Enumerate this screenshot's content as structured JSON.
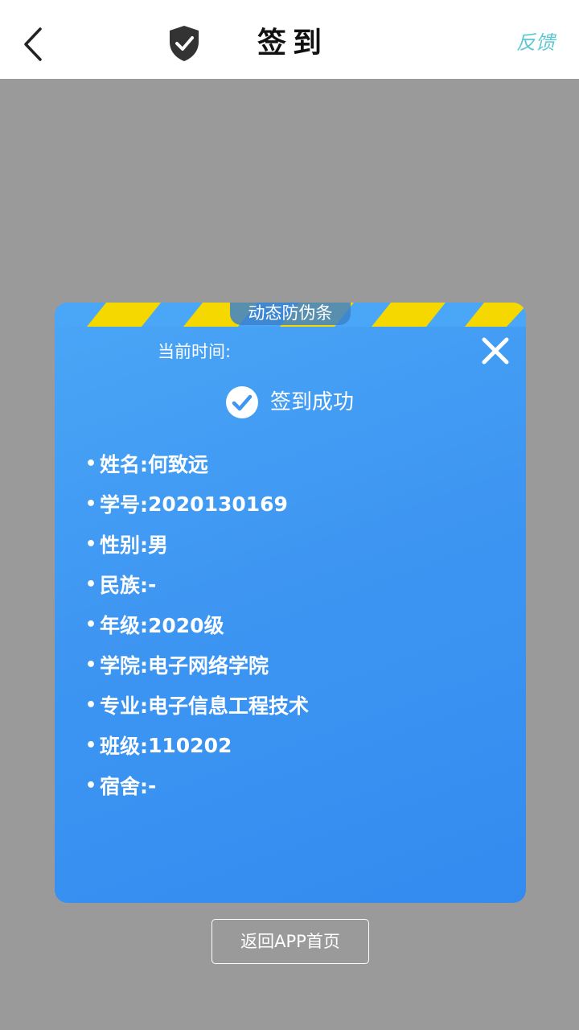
{
  "header": {
    "title": "签到",
    "feedback": "反馈"
  },
  "card": {
    "anti_counterfeit": "动态防伪条",
    "current_time_label": "当前时间:",
    "success_text": "签到成功",
    "fields": [
      {
        "label": "姓名:",
        "value": "何致远"
      },
      {
        "label": "学号:",
        "value": "2020130169"
      },
      {
        "label": "性别:",
        "value": "男"
      },
      {
        "label": "民族:",
        "value": "-"
      },
      {
        "label": "年级:",
        "value": "2020级"
      },
      {
        "label": "学院:",
        "value": "电子网络学院"
      },
      {
        "label": "专业:",
        "value": "电子信息工程技术"
      },
      {
        "label": "班级:",
        "value": "110202"
      },
      {
        "label": "宿舍:",
        "value": "-"
      }
    ]
  },
  "footer": {
    "home_button": "返回APP首页"
  },
  "colors": {
    "card_blue": "#3e96f2",
    "stripe_yellow": "#f5d800",
    "feedback_teal": "#5fc7d3",
    "overlay_gray": "#9a9a9a"
  },
  "icons": [
    "back-arrow-icon",
    "shield-check-icon",
    "close-icon",
    "check-circle-icon"
  ]
}
